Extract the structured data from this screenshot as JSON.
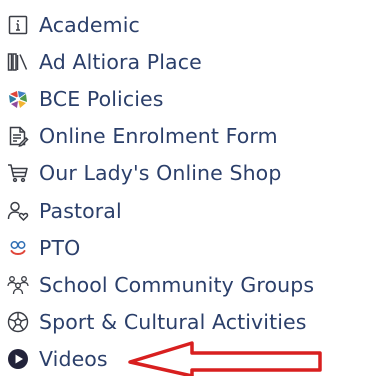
{
  "colors": {
    "text": "#2b3f6a",
    "icon_outline": "#3a3d45",
    "annotation_arrow": "#d81f1f"
  },
  "menu": {
    "items": [
      {
        "label": "Academic",
        "icon": "info-card-icon"
      },
      {
        "label": "Ad Altiora Place",
        "icon": "books-icon"
      },
      {
        "label": "BCE Policies",
        "icon": "bce-logo-icon"
      },
      {
        "label": "Online Enrolment Form",
        "icon": "form-edit-icon"
      },
      {
        "label": "Our Lady's Online Shop",
        "icon": "shopping-cart-icon"
      },
      {
        "label": "Pastoral",
        "icon": "person-heart-icon"
      },
      {
        "label": "PTO",
        "icon": "pto-logo-icon"
      },
      {
        "label": "School Community Groups",
        "icon": "people-group-icon"
      },
      {
        "label": "Sport & Cultural Activities",
        "icon": "soccer-ball-icon"
      },
      {
        "label": "Videos",
        "icon": "play-circle-icon"
      }
    ]
  }
}
